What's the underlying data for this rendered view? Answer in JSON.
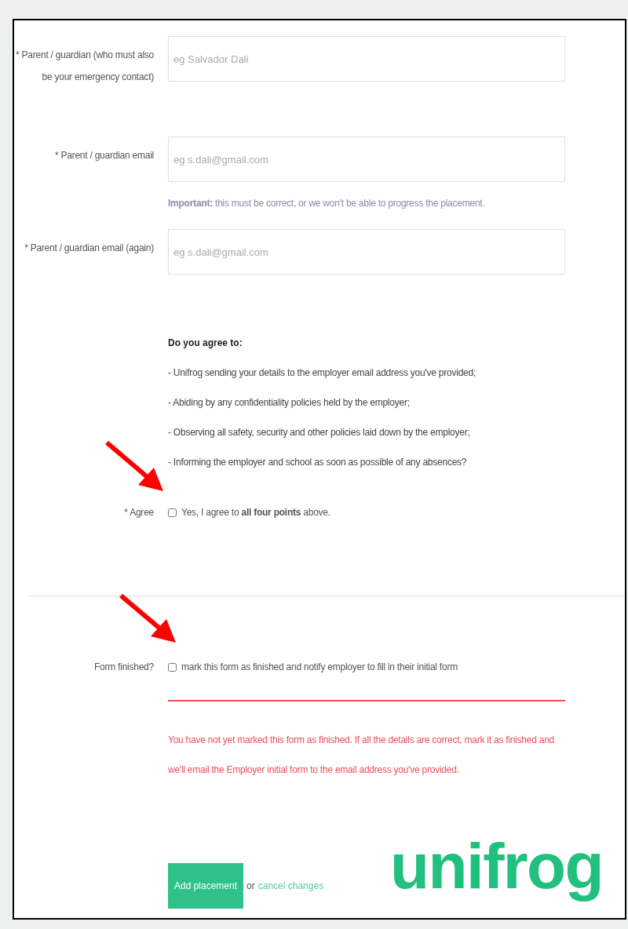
{
  "fields": [
    {
      "label": "* Parent / guardian (who must also be your emergency contact)",
      "placeholder": "eg Salvador Dali"
    },
    {
      "label": "* Parent / guardian email",
      "placeholder": "eg s.dali@gmail.com",
      "hint": "**Important:** this must be correct, or we won't be able to progress the placement."
    },
    {
      "label": "* Parent / guardian email (again)",
      "placeholder": "eg s.dali@gmail.com"
    }
  ],
  "agreement": {
    "heading": "Do you agree to:",
    "points": [
      "- Unifrog sending your details to the employer email address you've provided;",
      "- Abiding by any confidentiality policies held by the employer;",
      "- Observing all safety, security and other policies laid down by the employer;",
      "- Informing the employer and school as soon as possible of any absences?"
    ],
    "label": "* Agree",
    "checkbox_text": "Yes, I agree to **all four points** above.",
    "checked": false
  },
  "form_finished": {
    "label": "Form finished?",
    "checkbox_text": "mark this form as finished and notify employer to fill in their initial form",
    "checked": false,
    "warning": "You have not yet marked this form as finished. If all the details are correct, mark it as finished and we'll email the Employer initial form to the email address you've provided."
  },
  "actions": {
    "button": "Add placement",
    "or_text": "or",
    "link": "cancel changes"
  },
  "logo": "unifrog"
}
